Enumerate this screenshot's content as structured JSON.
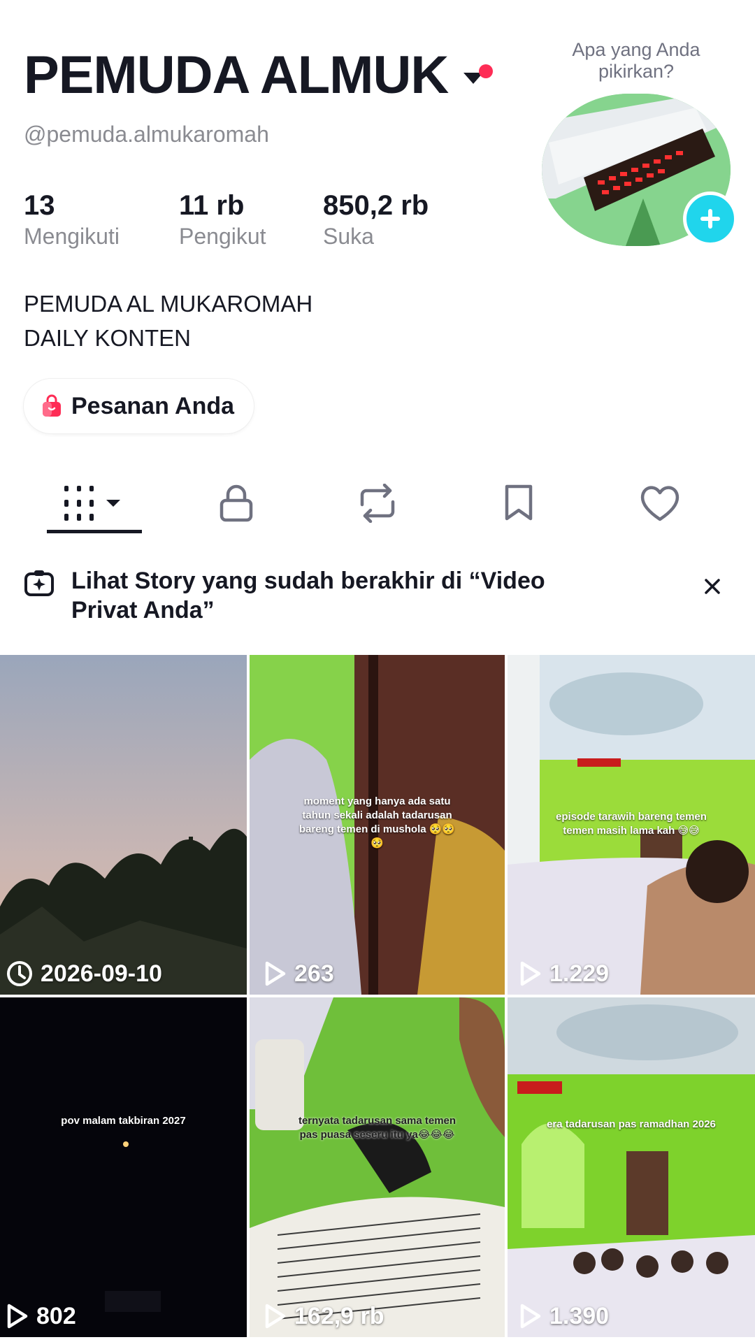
{
  "profile": {
    "display_name": "PEMUDA ALMUK",
    "handle": "@pemuda.almukaromah",
    "thought_prompt": "Apa yang Anda pikirkan?",
    "stats": [
      {
        "value": "13",
        "label": "Mengikuti"
      },
      {
        "value": "11 rb",
        "label": "Pengikut"
      },
      {
        "value": "850,2 rb",
        "label": "Suka"
      }
    ],
    "bio_lines": [
      "PEMUDA AL MUKAROMAH",
      "DAILY KONTEN"
    ],
    "orders_label": "Pesanan Anda"
  },
  "tabs": {
    "icons": [
      "grid-videos-icon",
      "lock-icon",
      "repost-icon",
      "bookmark-icon",
      "heart-icon"
    ],
    "active_index": 0
  },
  "story_banner": {
    "text": "Lihat Story yang sudah berakhir di “Video Privat Anda”"
  },
  "videos": [
    {
      "count": "2026-09-10",
      "icon": "clock-icon",
      "caption": ""
    },
    {
      "count": "263",
      "icon": "play-icon",
      "caption": "moment yang hanya ada satu tahun sekali adalah tadarusan bareng temen di mushola 🥺🥺🥺"
    },
    {
      "count": "1.229",
      "icon": "play-icon",
      "caption": "episode tarawih bareng temen temen masih lama kah 😅😅"
    },
    {
      "count": "802",
      "icon": "play-icon",
      "caption": "pov malam takbiran 2027"
    },
    {
      "count": "162,9 rb",
      "icon": "play-icon",
      "caption": "ternyata tadarusan sama temen pas puasa seseru itu ya😂😂😂"
    },
    {
      "count": "1.390",
      "icon": "play-icon",
      "caption": "era tadarusan pas ramadhan 2026"
    }
  ],
  "colors": {
    "text": "#161823",
    "secondary": "#8a8b91",
    "accent_pink": "#fe2c55",
    "accent_cyan": "#20d5ec"
  }
}
